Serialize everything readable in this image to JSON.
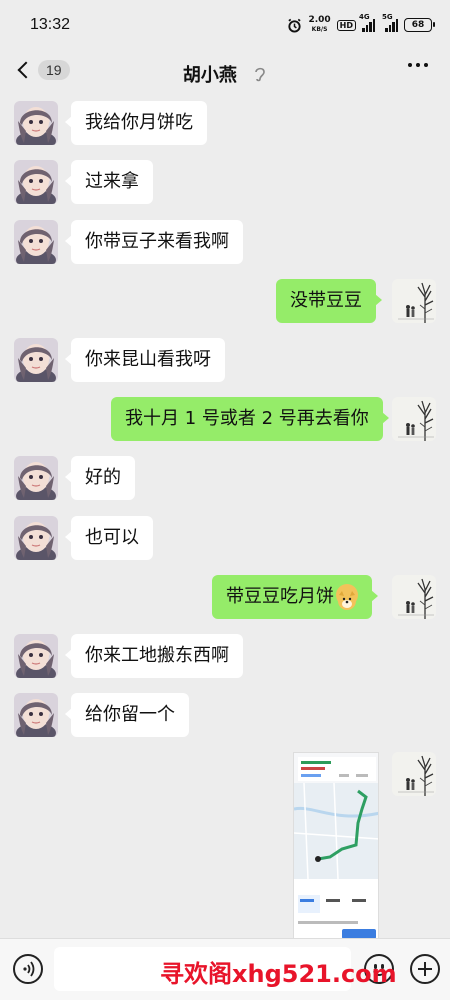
{
  "status_bar": {
    "time": "13:32",
    "net_speed": "2.00",
    "net_unit": "KB/S",
    "hd": "HD",
    "sig1": "4G",
    "sig2": "5G",
    "battery": "68",
    "icons": [
      "alarm-icon",
      "signal-icon",
      "battery-icon"
    ]
  },
  "header": {
    "back_count": "19",
    "title": "胡小燕",
    "icons": [
      "back-chevron-icon",
      "ear-icon",
      "more-icon"
    ]
  },
  "messages": [
    {
      "side": "in",
      "text": "我给你月饼吃"
    },
    {
      "side": "in",
      "text": "过来拿"
    },
    {
      "side": "in",
      "text": "你带豆子来看我啊"
    },
    {
      "side": "out",
      "text": "没带豆豆"
    },
    {
      "side": "in",
      "text": "你来昆山看我呀"
    },
    {
      "side": "out",
      "text": "我十月 1 号或者 2 号再去看你"
    },
    {
      "side": "in",
      "text": "好的"
    },
    {
      "side": "in",
      "text": "也可以"
    },
    {
      "side": "out",
      "text": "带豆豆吃月饼",
      "emoji": "dog-emoji"
    },
    {
      "side": "in",
      "text": "你来工地搬东西啊"
    },
    {
      "side": "in",
      "text": "给你留一个"
    },
    {
      "side": "out",
      "type": "image",
      "content": "map-screenshot"
    }
  ],
  "input_bar": {
    "icons": [
      "voice-icon",
      "emoji-icon",
      "plus-icon"
    ]
  },
  "watermark": "寻欢阁xhg521.com",
  "colors": {
    "background": "#ededed",
    "incoming_bubble": "#ffffff",
    "outgoing_bubble": "#95ec69",
    "watermark": "#e8142a"
  }
}
